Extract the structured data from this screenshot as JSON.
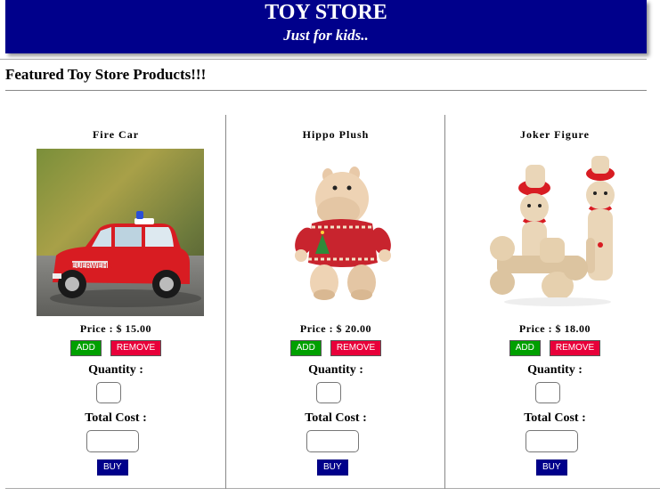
{
  "header": {
    "title": "TOY STORE",
    "subtitle": "Just for kids.."
  },
  "section_title": "Featured Toy Store Products!!!",
  "products": [
    {
      "name": "Fire Car",
      "price": "Price : $ 15.00",
      "add": "ADD",
      "remove": "REMOVE",
      "quantity_label": "Quantity :",
      "quantity_value": "",
      "total_label": "Total Cost :",
      "total_value": "",
      "buy": "BUY"
    },
    {
      "name": "Hippo Plush",
      "price": "Price : $ 20.00",
      "add": "ADD",
      "remove": "REMOVE",
      "quantity_label": "Quantity :",
      "quantity_value": "",
      "total_label": "Total Cost :",
      "total_value": "",
      "buy": "BUY"
    },
    {
      "name": "Joker Figure",
      "price": "Price : $ 18.00",
      "add": "ADD",
      "remove": "REMOVE",
      "quantity_label": "Quantity :",
      "quantity_value": "",
      "total_label": "Total Cost :",
      "total_value": "",
      "buy": "BUY"
    }
  ],
  "colors": {
    "header_bg": "#00008b",
    "add_button": "#00a000",
    "remove_button": "#e8003a",
    "buy_button": "#00008b"
  }
}
